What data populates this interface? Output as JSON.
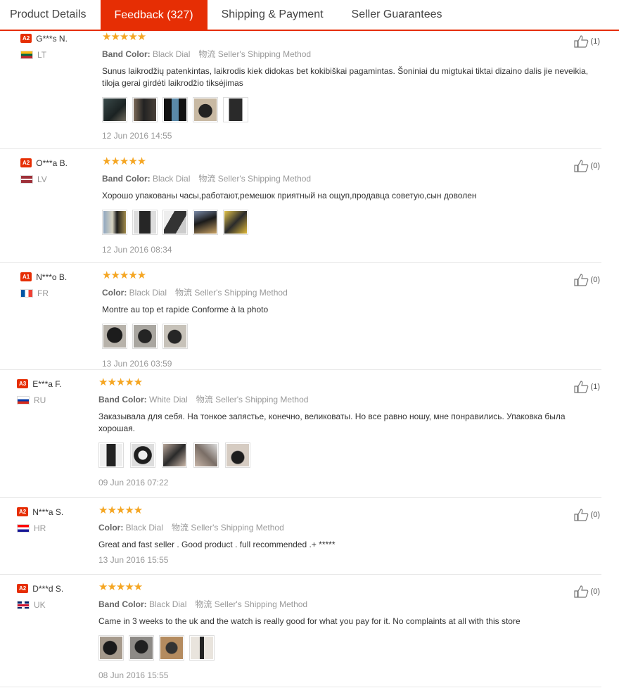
{
  "tabs": [
    {
      "label": "Product Details",
      "active": false
    },
    {
      "label": "Feedback (327)",
      "active": true
    },
    {
      "label": "Shipping & Payment",
      "active": false
    },
    {
      "label": "Seller Guarantees",
      "active": false
    }
  ],
  "feedback": [
    {
      "badge": "A2",
      "user": "G***s N.",
      "country": "LT",
      "stars": "★★★★★",
      "attr_label": "Band Color:",
      "attr_value": "Black Dial",
      "ship_cn": "物流",
      "ship": "Seller's Shipping Method",
      "text": "Sunus laikrodžių patenkintas, laikrodis kiek didokas bet kokibiškai pagamintas. Šoniniai du migtukai tiktai dizaino dalis jie neveikia, tiloja gerai girdėti laikrodžio tiksėjimas",
      "date": "12 Jun 2016 14:55",
      "helpful": "(1)",
      "photos": 5
    },
    {
      "badge": "A2",
      "user": "O***a B.",
      "country": "LV",
      "stars": "★★★★★",
      "attr_label": "Band Color:",
      "attr_value": "Black Dial",
      "ship_cn": "物流",
      "ship": "Seller's Shipping Method",
      "text": "Хорошо упакованы часы,работают,ремешок приятный на ощуп,продавца советую,сын доволен",
      "date": "12 Jun 2016 08:34",
      "helpful": "(0)",
      "photos": 5
    },
    {
      "badge": "A1",
      "user": "N***o B.",
      "country": "FR",
      "stars": "★★★★★",
      "attr_label": "Color:",
      "attr_value": "Black Dial",
      "ship_cn": "物流",
      "ship": "Seller's Shipping Method",
      "text": "Montre au top et rapide Conforme à la photo",
      "date": "13 Jun 2016 03:59",
      "helpful": "(0)",
      "photos": 3
    },
    {
      "badge": "A3",
      "user": "E***a F.",
      "country": "RU",
      "stars": "★★★★★",
      "attr_label": "Band Color:",
      "attr_value": "White Dial",
      "ship_cn": "物流",
      "ship": "Seller's Shipping Method",
      "text": "Заказывала для себя. На тонкое запястье, конечно, великоваты. Но все равно ношу, мне понравились. Упаковка была хорошая.",
      "date": "09 Jun 2016 07:22",
      "helpful": "(1)",
      "photos": 5
    },
    {
      "badge": "A2",
      "user": "N***a S.",
      "country": "HR",
      "stars": "★★★★★",
      "attr_label": "Color:",
      "attr_value": "Black Dial",
      "ship_cn": "物流",
      "ship": "Seller's Shipping Method",
      "text": "Great and fast seller . Good product . full recommended .+ *****",
      "date": "13 Jun 2016 15:55",
      "helpful": "(0)",
      "photos": 0
    },
    {
      "badge": "A2",
      "user": "D***d S.",
      "country": "UK",
      "stars": "★★★★★",
      "attr_label": "Band Color:",
      "attr_value": "Black Dial",
      "ship_cn": "物流",
      "ship": "Seller's Shipping Method",
      "text": "Came in 3 weeks to the uk and the watch is really good for what you pay for it. No complaints at all with this store",
      "date": "08 Jun 2016 15:55",
      "helpful": "(0)",
      "photos": 4
    }
  ]
}
